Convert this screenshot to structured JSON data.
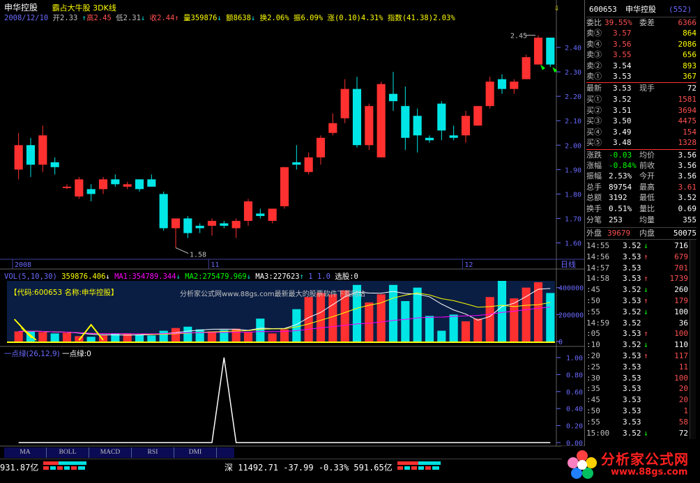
{
  "header": {
    "stock_name": "申华控股",
    "subtitle": "霸占大牛股 3DK线",
    "date": "2008/12/10",
    "open_label": "开",
    "open": "2.33",
    "high_label": "高",
    "high": "2.45",
    "low_label": "低",
    "low": "2.31",
    "close_label": "收",
    "close": "2.44",
    "vol_label": "量",
    "vol": "359876",
    "amt_label": "额",
    "amt": "8638",
    "turnover_label": "换",
    "turnover": "2.06%",
    "amplitude_label": "振",
    "amplitude": "6.09%",
    "rise_label": "涨",
    "rise": "(0.10)4.31%",
    "index_label": "指数",
    "index": "(41.38)2.03%"
  },
  "price_axis": [
    "2.45",
    "2.40",
    "2.30",
    "2.20",
    "2.10",
    "2.00",
    "1.90",
    "1.80",
    "1.70",
    "1.60"
  ],
  "price_markers": {
    "high": "2.45",
    "low": "1.58"
  },
  "x_axis": {
    "labels": [
      "2008",
      "11",
      "12"
    ],
    "period": "日线"
  },
  "volume": {
    "header": "VOL(5,10,30)",
    "value": "359876.406",
    "ma1": "MA1:354789.344",
    "ma2": "MA2:275479.969",
    "ma3": "MA3:227623",
    "extra1": "1",
    "extra2": "1.0",
    "select": "选股:0",
    "axis": [
      "400000",
      "200000",
      "0"
    ],
    "banner_code": "【代码:600653 名称:申华控股】",
    "banner_site": "分析家公式网www.88gs.com最新最大的股票软件下载网站"
  },
  "indicator": {
    "title": "一点绿(26,12,9)",
    "value": "一点绿:0",
    "axis": [
      "1.00",
      "0.80",
      "0.60",
      "0.40",
      "0.20",
      "0.00"
    ]
  },
  "tabs": [
    "MA",
    "BOLL",
    "MACD",
    "RSI",
    "DMI"
  ],
  "status": {
    "amount": "931.87亿",
    "shenzhen": "深 11492.71 -37.99 -0.33% 591.65亿"
  },
  "logo": {
    "line1": "分析家公式网",
    "line2": "www.88gs.com"
  },
  "panel": {
    "code": "600653",
    "name": "申华控股",
    "num": "(552)",
    "webi_label": "委比",
    "webi": "39.55%",
    "weicha_label": "委差",
    "weicha": "6366",
    "sells": [
      {
        "label": "卖⑤",
        "price": "3.57",
        "vol": "864"
      },
      {
        "label": "卖④",
        "price": "3.56",
        "vol": "2086"
      },
      {
        "label": "卖③",
        "price": "3.55",
        "vol": "656"
      },
      {
        "label": "卖②",
        "price": "3.54",
        "vol": "893"
      },
      {
        "label": "卖①",
        "price": "3.53",
        "vol": "367"
      }
    ],
    "latest_label": "最新",
    "latest": "3.53",
    "xianshou_label": "现手",
    "xianshou": "72",
    "buys": [
      {
        "label": "买①",
        "price": "3.52",
        "vol": "1581"
      },
      {
        "label": "买②",
        "price": "3.51",
        "vol": "3694"
      },
      {
        "label": "买③",
        "price": "3.50",
        "vol": "4475"
      },
      {
        "label": "买④",
        "price": "3.49",
        "vol": "154"
      },
      {
        "label": "买⑤",
        "price": "3.48",
        "vol": "1328"
      }
    ],
    "stats": [
      {
        "l1": "涨跌",
        "v1": "-0.03",
        "l2": "均价",
        "v2": "3.56",
        "c1": "g",
        "c2": "w"
      },
      {
        "l1": "涨幅",
        "v1": "-0.84%",
        "l2": "前收",
        "v2": "3.56",
        "c1": "g",
        "c2": "w"
      },
      {
        "l1": "振幅",
        "v1": "2.53%",
        "l2": "今开",
        "v2": "3.56",
        "c1": "w",
        "c2": "w"
      },
      {
        "l1": "总手",
        "v1": "89754",
        "l2": "最高",
        "v2": "3.61",
        "c1": "w",
        "c2": "r"
      },
      {
        "l1": "总额",
        "v1": "3192",
        "l2": "最低",
        "v2": "3.52",
        "c1": "w",
        "c2": "w"
      },
      {
        "l1": "换手",
        "v1": "0.51%",
        "l2": "量比",
        "v2": "0.69",
        "c1": "w",
        "c2": "w"
      },
      {
        "l1": "分笔",
        "v1": "253",
        "l2": "均量",
        "v2": "355",
        "c1": "w",
        "c2": "w"
      }
    ],
    "waipan_label": "外盘",
    "waipan": "39679",
    "neipan_label": "内盘",
    "neipan": "50075",
    "ticks": [
      {
        "t": "14:55",
        "p": "3.52",
        "d": "↓",
        "v": "716",
        "c": "w"
      },
      {
        "t": "14:56",
        "p": "3.53",
        "d": "↑",
        "v": "679",
        "c": "r"
      },
      {
        "t": "14:57",
        "p": "3.53",
        "d": "",
        "v": "701",
        "c": "r"
      },
      {
        "t": "14:58",
        "p": "3.53",
        "d": "↑",
        "v": "1739",
        "c": "r"
      },
      {
        "t": ":45",
        "p": "3.52",
        "d": "↓",
        "v": "260",
        "c": "w"
      },
      {
        "t": ":50",
        "p": "3.53",
        "d": "↑",
        "v": "179",
        "c": "r"
      },
      {
        "t": ":55",
        "p": "3.52",
        "d": "↓",
        "v": "100",
        "c": "w"
      },
      {
        "t": "14:59",
        "p": "3.52",
        "d": "",
        "v": "36",
        "c": "w"
      },
      {
        "t": ":05",
        "p": "3.53",
        "d": "↑",
        "v": "100",
        "c": "r"
      },
      {
        "t": ":10",
        "p": "3.52",
        "d": "↓",
        "v": "110",
        "c": "w"
      },
      {
        "t": ":20",
        "p": "3.53",
        "d": "↑",
        "v": "117",
        "c": "r"
      },
      {
        "t": ":25",
        "p": "3.53",
        "d": "",
        "v": "11",
        "c": "r"
      },
      {
        "t": ":30",
        "p": "3.53",
        "d": "",
        "v": "100",
        "c": "r"
      },
      {
        "t": ":35",
        "p": "3.53",
        "d": "",
        "v": "20",
        "c": "r"
      },
      {
        "t": ":45",
        "p": "3.53",
        "d": "",
        "v": "20",
        "c": "r"
      },
      {
        "t": ":50",
        "p": "3.53",
        "d": "",
        "v": "1",
        "c": "r"
      },
      {
        "t": ":55",
        "p": "3.53",
        "d": "",
        "v": "58",
        "c": "r"
      },
      {
        "t": "15:00",
        "p": "3.52",
        "d": "↓",
        "v": "72",
        "c": "w"
      }
    ]
  },
  "chart_data": [
    {
      "type": "candlestick",
      "ylim": [
        1.55,
        2.48
      ],
      "candles": [
        {
          "o": 1.9,
          "h": 2.05,
          "l": 1.86,
          "c": 2.0
        },
        {
          "o": 2.0,
          "h": 2.03,
          "l": 1.87,
          "c": 1.92
        },
        {
          "o": 1.92,
          "h": 2.08,
          "l": 1.89,
          "c": 2.04
        },
        {
          "o": 1.93,
          "h": 1.95,
          "l": 1.88,
          "c": 1.91
        },
        {
          "o": 1.83,
          "h": 1.84,
          "l": 1.82,
          "c": 1.83
        },
        {
          "o": 1.79,
          "h": 1.87,
          "l": 1.78,
          "c": 1.86
        },
        {
          "o": 1.82,
          "h": 1.84,
          "l": 1.77,
          "c": 1.8
        },
        {
          "o": 1.82,
          "h": 1.87,
          "l": 1.8,
          "c": 1.86
        },
        {
          "o": 1.86,
          "h": 1.88,
          "l": 1.83,
          "c": 1.84
        },
        {
          "o": 1.83,
          "h": 1.85,
          "l": 1.82,
          "c": 1.84
        },
        {
          "o": 1.86,
          "h": 1.86,
          "l": 1.81,
          "c": 1.82
        },
        {
          "o": 1.86,
          "h": 1.88,
          "l": 1.83,
          "c": 1.83
        },
        {
          "o": 1.8,
          "h": 1.81,
          "l": 1.65,
          "c": 1.66
        },
        {
          "o": 1.66,
          "h": 1.69,
          "l": 1.58,
          "c": 1.7
        },
        {
          "o": 1.7,
          "h": 1.71,
          "l": 1.62,
          "c": 1.64
        },
        {
          "o": 1.67,
          "h": 1.68,
          "l": 1.64,
          "c": 1.66
        },
        {
          "o": 1.67,
          "h": 1.7,
          "l": 1.63,
          "c": 1.69
        },
        {
          "o": 1.68,
          "h": 1.69,
          "l": 1.66,
          "c": 1.67
        },
        {
          "o": 1.66,
          "h": 1.7,
          "l": 1.62,
          "c": 1.69
        },
        {
          "o": 1.69,
          "h": 1.78,
          "l": 1.67,
          "c": 1.77
        },
        {
          "o": 1.72,
          "h": 1.74,
          "l": 1.7,
          "c": 1.71
        },
        {
          "o": 1.69,
          "h": 1.74,
          "l": 1.68,
          "c": 1.74
        },
        {
          "o": 1.75,
          "h": 1.91,
          "l": 1.74,
          "c": 1.91
        },
        {
          "o": 1.93,
          "h": 2.0,
          "l": 1.9,
          "c": 1.92
        },
        {
          "o": 1.89,
          "h": 1.97,
          "l": 1.88,
          "c": 1.95
        },
        {
          "o": 1.95,
          "h": 2.04,
          "l": 1.92,
          "c": 2.03
        },
        {
          "o": 2.05,
          "h": 2.13,
          "l": 2.04,
          "c": 2.09
        },
        {
          "o": 2.11,
          "h": 2.27,
          "l": 2.09,
          "c": 2.23
        },
        {
          "o": 2.23,
          "h": 2.28,
          "l": 1.99,
          "c": 2.0
        },
        {
          "o": 2.0,
          "h": 2.17,
          "l": 1.98,
          "c": 2.16
        },
        {
          "o": 1.95,
          "h": 2.26,
          "l": 1.95,
          "c": 2.25
        },
        {
          "o": 2.21,
          "h": 2.3,
          "l": 2.14,
          "c": 2.18
        },
        {
          "o": 2.16,
          "h": 2.24,
          "l": 1.98,
          "c": 2.03
        },
        {
          "o": 2.12,
          "h": 2.15,
          "l": 1.97,
          "c": 2.04
        },
        {
          "o": 2.03,
          "h": 2.04,
          "l": 2.01,
          "c": 2.02
        },
        {
          "o": 2.17,
          "h": 2.18,
          "l": 2.02,
          "c": 2.06
        },
        {
          "o": 2.04,
          "h": 2.08,
          "l": 2.02,
          "c": 2.03
        },
        {
          "o": 2.04,
          "h": 2.14,
          "l": 2.01,
          "c": 2.12
        },
        {
          "o": 2.08,
          "h": 2.16,
          "l": 2.08,
          "c": 2.16
        },
        {
          "o": 2.16,
          "h": 2.28,
          "l": 2.15,
          "c": 2.26
        },
        {
          "o": 2.27,
          "h": 2.29,
          "l": 2.21,
          "c": 2.23
        },
        {
          "o": 2.23,
          "h": 2.27,
          "l": 2.21,
          "c": 2.26
        },
        {
          "o": 2.27,
          "h": 2.37,
          "l": 2.27,
          "c": 2.36
        },
        {
          "o": 2.33,
          "h": 2.45,
          "l": 2.33,
          "c": 2.44
        },
        {
          "o": 2.44,
          "h": 2.44,
          "l": 2.32,
          "c": 2.33
        }
      ]
    },
    {
      "type": "bar",
      "name": "VOL",
      "ylim": [
        0,
        450000
      ],
      "values": [
        75000,
        80000,
        70000,
        60000,
        65000,
        40000,
        35000,
        45000,
        60000,
        55000,
        50000,
        45000,
        80000,
        100000,
        110000,
        90000,
        75000,
        85000,
        95000,
        70000,
        170000,
        60000,
        90000,
        240000,
        330000,
        360000,
        350000,
        380000,
        420000,
        290000,
        350000,
        420000,
        300000,
        400000,
        190000,
        80000,
        200000,
        150000,
        170000,
        330000,
        450000,
        320000,
        400000,
        440000,
        360000
      ],
      "ma_lines": [
        {
          "name": "MA1",
          "color": "#ffffff"
        },
        {
          "name": "MA2",
          "color": "#ffff00"
        },
        {
          "name": "MA3",
          "color": "#ff00ff"
        }
      ]
    },
    {
      "type": "line",
      "name": "一点绿",
      "ylim": [
        0,
        1.1
      ],
      "values": [
        0,
        0,
        0,
        0,
        0,
        0,
        0,
        0,
        0,
        0,
        0,
        0,
        0,
        0,
        0,
        0,
        0,
        1,
        0,
        0,
        0,
        0,
        0,
        0,
        0,
        0,
        0,
        0,
        0,
        0,
        0,
        0,
        0,
        0,
        0,
        0,
        0,
        0,
        0,
        0,
        0,
        0,
        0,
        0,
        0
      ]
    }
  ]
}
